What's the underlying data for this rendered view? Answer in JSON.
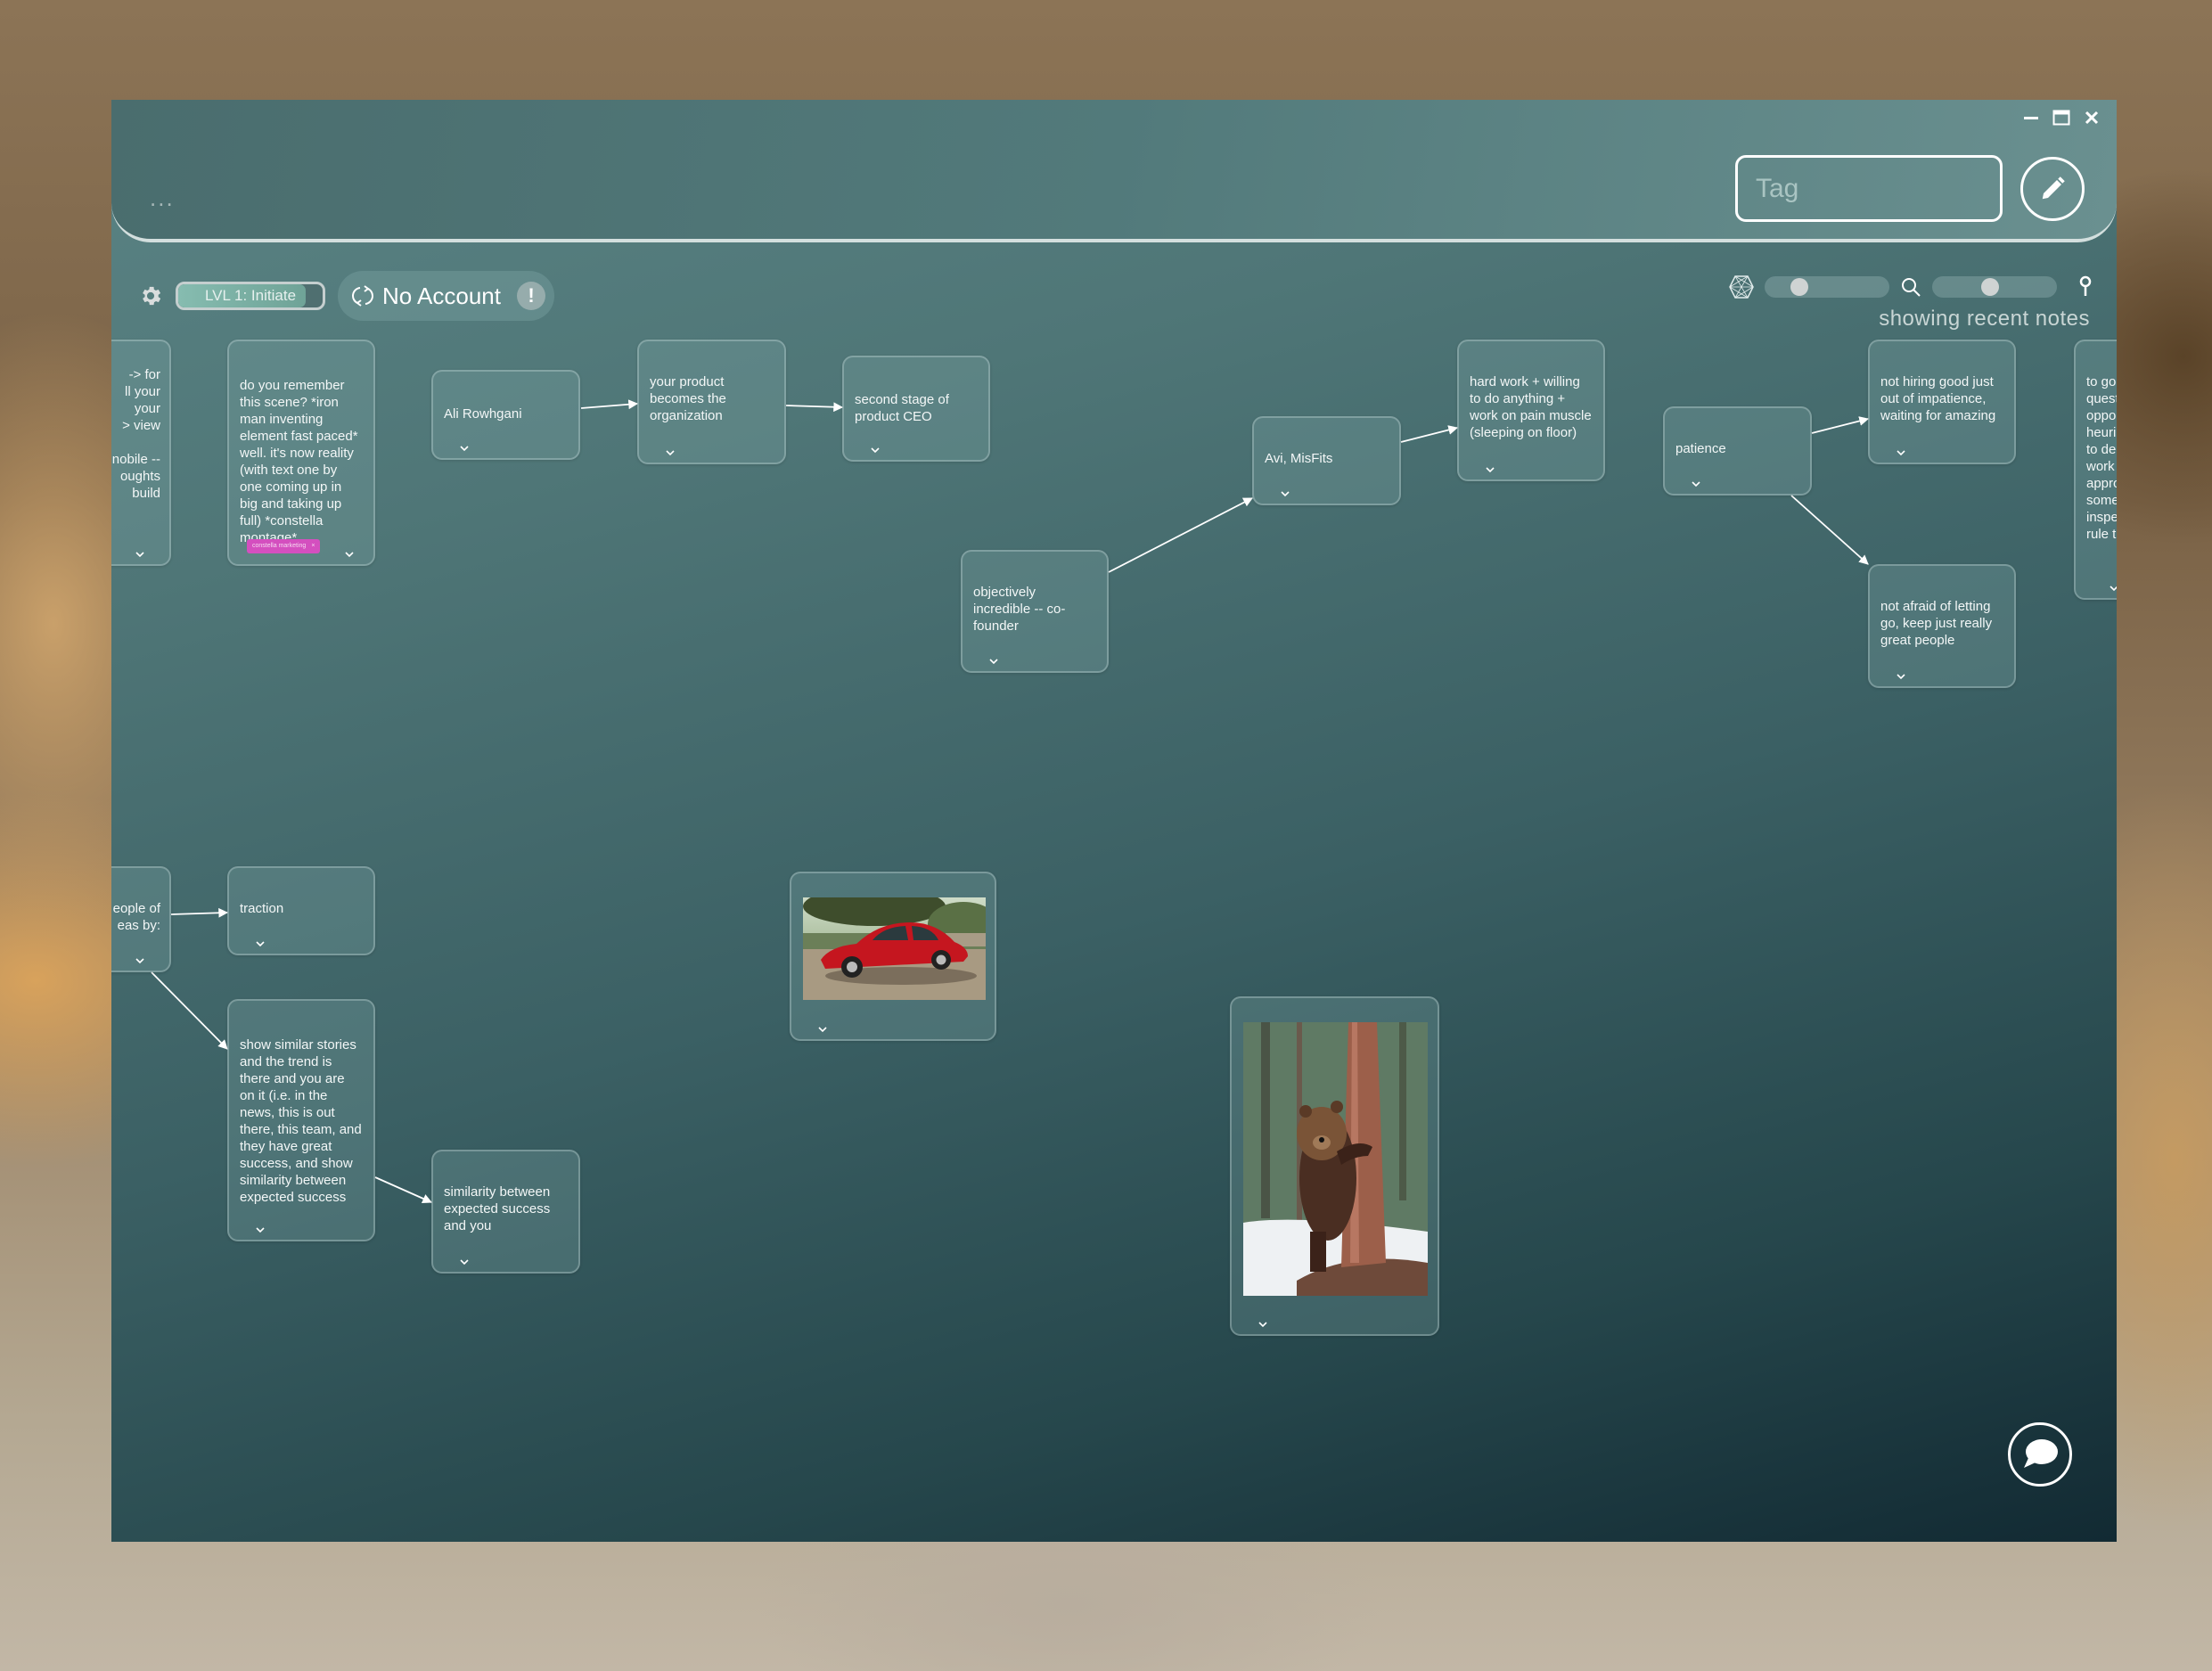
{
  "window": {
    "controls": {
      "minimize": "minimize-icon",
      "maximize": "maximize-icon",
      "close": "close-icon"
    }
  },
  "header": {
    "more_label": "...",
    "tag_input": {
      "placeholder": "Tag",
      "value": ""
    },
    "edit_button_icon": "pencil-icon"
  },
  "toolbar": {
    "settings_icon": "gear-icon",
    "level": {
      "label": "LVL 1: Initiate",
      "progress": 0.88
    },
    "account": {
      "label": "No Account",
      "sync_icon": "sync-icon",
      "alert": "!"
    },
    "network_slider": {
      "icon": "hexagon-network-icon",
      "value": 0.24
    },
    "zoom_slider": {
      "icon": "search-icon",
      "value": 0.46
    },
    "pin_icon": "pin-icon",
    "status_text": "showing recent notes"
  },
  "cards": [
    {
      "id": "c0",
      "text": "-> for\nll your\nyour\n> view\n\nnobile --\noughts\n build",
      "clipped": "left"
    },
    {
      "id": "c1",
      "text": "do you remember this scene? *iron man inventing element fast paced* well. it's now reality (with text one by one coming up in big and taking up full) *constella montage*",
      "tag": "constella marketing"
    },
    {
      "id": "c2",
      "text": "Ali Rowhgani"
    },
    {
      "id": "c3",
      "text": "your product becomes the organization"
    },
    {
      "id": "c4",
      "text": "second stage of product CEO"
    },
    {
      "id": "c5",
      "text": "objectively incredible -- co-founder"
    },
    {
      "id": "c6",
      "text": "Avi, MisFits"
    },
    {
      "id": "c7",
      "text": "hard work + willing to do anything + work on pain muscle (sleeping on floor)"
    },
    {
      "id": "c8",
      "text": "patience"
    },
    {
      "id": "c9",
      "text": "not hiring good just out of impatience, waiting for amazing"
    },
    {
      "id": "c10",
      "text": "not afraid of letting go, keep just really great people"
    },
    {
      "id": "c11",
      "text": "to go\nquest\noppo\nheuri\nto de\nwork\nappro\nsome\ninspe\nrule t",
      "clipped": "right"
    },
    {
      "id": "c12",
      "text": "eople of\neas by:",
      "clipped": "left"
    },
    {
      "id": "c13",
      "text": "traction"
    },
    {
      "id": "c14",
      "text": "show similar stories and the trend is there and you are on it (i.e. in the news, this is out there, this team, and they have great success, and show similarity between expected success"
    },
    {
      "id": "c15",
      "text": "similarity between expected success and you"
    },
    {
      "id": "c16",
      "image": "red-classic-car-photo"
    },
    {
      "id": "c17",
      "image": "brown-bear-hugging-tree-photo"
    }
  ],
  "links": [
    [
      "c2",
      "c3"
    ],
    [
      "c3",
      "c4"
    ],
    [
      "c5",
      "c6"
    ],
    [
      "c6",
      "c7"
    ],
    [
      "c8",
      "c9"
    ],
    [
      "c8",
      "c10"
    ],
    [
      "c12",
      "c13"
    ],
    [
      "c12",
      "c14"
    ],
    [
      "c14",
      "c15"
    ]
  ],
  "chat_button_icon": "chat-bubble-icon"
}
